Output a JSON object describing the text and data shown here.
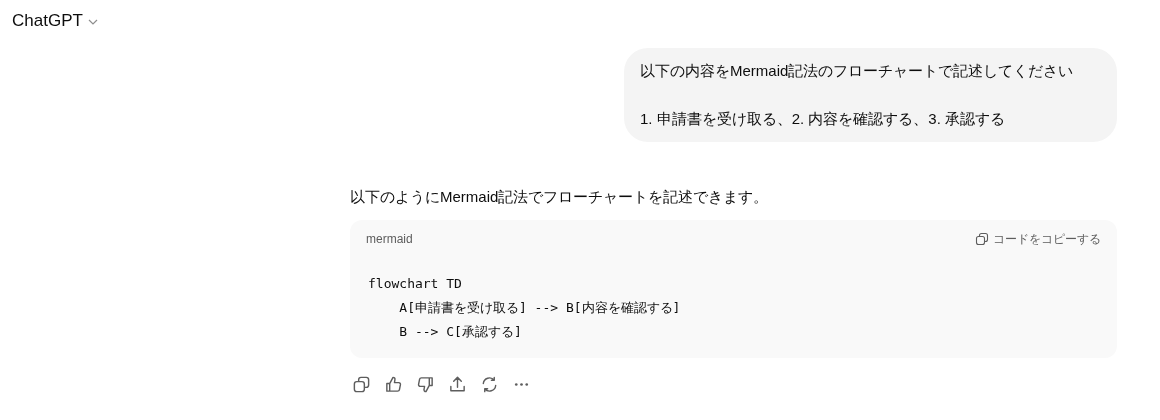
{
  "header": {
    "title": "ChatGPT"
  },
  "user_message": {
    "paragraphs": [
      "以下の内容をMermaid記法のフローチャートで記述してください",
      "1. 申請書を受け取る、2. 内容を確認する、3. 承認する"
    ]
  },
  "assistant_message": {
    "text": "以下のようにMermaid記法でフローチャートを記述できます。",
    "code_block": {
      "language": "mermaid",
      "copy_label": "コードをコピーする",
      "lines": [
        "flowchart TD",
        "    A[申請書を受け取る] --> B[内容を確認する]",
        "    B --> C[承認する]"
      ]
    }
  }
}
